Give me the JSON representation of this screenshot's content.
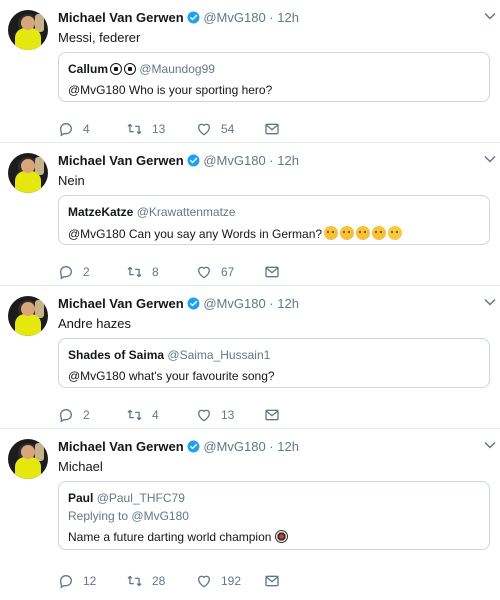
{
  "colors": {
    "link": "#1da1f2",
    "muted": "#657786",
    "text": "#14171a",
    "border": "#ccd6dd"
  },
  "tweets": [
    {
      "name": "Michael Van Gerwen",
      "handle": "@MvG180",
      "dot": "·",
      "time": "12h",
      "text": "Messi, federer",
      "quote": {
        "name": "Callum",
        "handle": "@Maundog99",
        "text": "@MvG180 Who is your sporting hero?"
      },
      "counts": {
        "replies": "4",
        "retweets": "13",
        "likes": "54"
      }
    },
    {
      "name": "Michael Van Gerwen",
      "handle": "@MvG180",
      "dot": "·",
      "time": "12h",
      "text": "Nein",
      "quote": {
        "name": "MatzeKatze",
        "handle": "@Krawattenmatze",
        "text": "@MvG180 Can you say any Words in German?"
      },
      "counts": {
        "replies": "2",
        "retweets": "8",
        "likes": "67"
      }
    },
    {
      "name": "Michael Van Gerwen",
      "handle": "@MvG180",
      "dot": "·",
      "time": "12h",
      "text": "Andre hazes",
      "quote": {
        "name": "Shades of Saima",
        "handle": "@Saima_Hussain1",
        "text": "@MvG180 what's your favourite song?"
      },
      "counts": {
        "replies": "2",
        "retweets": "4",
        "likes": "13"
      }
    },
    {
      "name": "Michael Van Gerwen",
      "handle": "@MvG180",
      "dot": "·",
      "time": "12h",
      "text": "Michael",
      "quote": {
        "name": "Paul",
        "handle": "@Paul_THFC79",
        "reply_prefix": "Replying to",
        "reply_to": "@MvG180",
        "text": "Name a future darting world champion"
      },
      "counts": {
        "replies": "12",
        "retweets": "28",
        "likes": "192"
      }
    }
  ]
}
